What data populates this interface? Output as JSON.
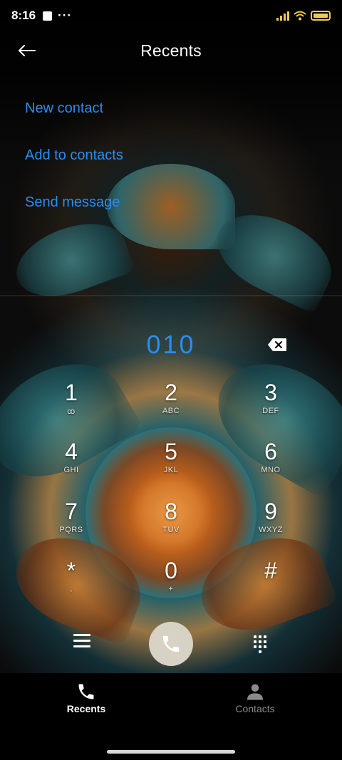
{
  "status_bar": {
    "time": "8:16",
    "more_dots": "···"
  },
  "header": {
    "title": "Recents",
    "back_icon": "arrow-left-icon"
  },
  "actions": [
    {
      "label": "New contact"
    },
    {
      "label": "Add to contacts"
    },
    {
      "label": "Send message"
    }
  ],
  "dialer": {
    "number": "010",
    "backspace_icon": "backspace-icon"
  },
  "keypad": [
    {
      "digit": "1",
      "letters": "ꝏ"
    },
    {
      "digit": "2",
      "letters": "ABC"
    },
    {
      "digit": "3",
      "letters": "DEF"
    },
    {
      "digit": "4",
      "letters": "GHI"
    },
    {
      "digit": "5",
      "letters": "JKL"
    },
    {
      "digit": "6",
      "letters": "MNO"
    },
    {
      "digit": "7",
      "letters": "PQRS"
    },
    {
      "digit": "8",
      "letters": "TUV"
    },
    {
      "digit": "9",
      "letters": "WXYZ"
    },
    {
      "digit": "*",
      "letters": ","
    },
    {
      "digit": "0",
      "letters": "+"
    },
    {
      "digit": "#",
      "letters": ""
    }
  ],
  "controls": {
    "menu_icon": "menu-icon",
    "call_icon": "phone-icon",
    "keypad_icon": "dialpad-icon"
  },
  "bottom_nav": [
    {
      "label": "Recents",
      "icon": "phone-icon",
      "active": true
    },
    {
      "label": "Contacts",
      "icon": "person-icon",
      "active": false
    }
  ],
  "colors": {
    "accent": "#2a8cf0",
    "call_button": "#d8d2c5",
    "status_yellow": "#f2c94c"
  }
}
